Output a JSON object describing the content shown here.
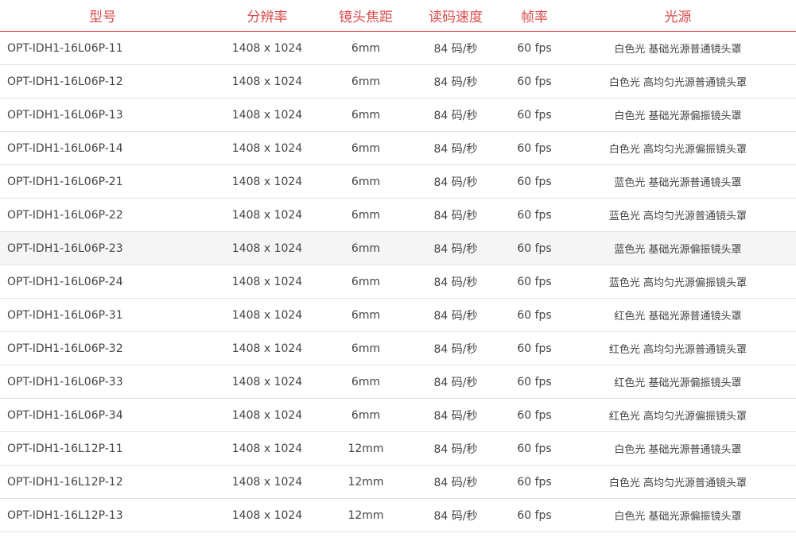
{
  "colors": {
    "header_text": "#d94c4c",
    "header_rule": "#d94c4c",
    "body_text": "#444444",
    "row_rule": "#e3e3e3",
    "highlight_row_bg": "#f5f5f5"
  },
  "table": {
    "headers": [
      "型号",
      "分辨率",
      "镜头焦距",
      "读码速度",
      "帧率",
      "光源"
    ],
    "highlighted_row": 6,
    "rows": [
      [
        "OPT-IDH1-16L06P-11",
        "1408 x 1024",
        "6mm",
        "84 码/秒",
        "60 fps",
        "白色光 基础光源普通镜头罩"
      ],
      [
        "OPT-IDH1-16L06P-12",
        "1408 x 1024",
        "6mm",
        "84 码/秒",
        "60 fps",
        "白色光 高均匀光源普通镜头罩"
      ],
      [
        "OPT-IDH1-16L06P-13",
        "1408 x 1024",
        "6mm",
        "84 码/秒",
        "60 fps",
        "白色光 基础光源偏振镜头罩"
      ],
      [
        "OPT-IDH1-16L06P-14",
        "1408 x 1024",
        "6mm",
        "84 码/秒",
        "60 fps",
        "白色光 高均匀光源偏振镜头罩"
      ],
      [
        "OPT-IDH1-16L06P-21",
        "1408 x 1024",
        "6mm",
        "84 码/秒",
        "60 fps",
        "蓝色光 基础光源普通镜头罩"
      ],
      [
        "OPT-IDH1-16L06P-22",
        "1408 x 1024",
        "6mm",
        "84 码/秒",
        "60 fps",
        "蓝色光 高均匀光源普通镜头罩"
      ],
      [
        "OPT-IDH1-16L06P-23",
        "1408 x 1024",
        "6mm",
        "84 码/秒",
        "60 fps",
        "蓝色光 基础光源偏振镜头罩"
      ],
      [
        "OPT-IDH1-16L06P-24",
        "1408 x 1024",
        "6mm",
        "84 码/秒",
        "60 fps",
        "蓝色光 高均匀光源偏振镜头罩"
      ],
      [
        "OPT-IDH1-16L06P-31",
        "1408 x 1024",
        "6mm",
        "84 码/秒",
        "60 fps",
        "红色光 基础光源普通镜头罩"
      ],
      [
        "OPT-IDH1-16L06P-32",
        "1408 x 1024",
        "6mm",
        "84 码/秒",
        "60 fps",
        "红色光 高均匀光源普通镜头罩"
      ],
      [
        "OPT-IDH1-16L06P-33",
        "1408 x 1024",
        "6mm",
        "84 码/秒",
        "60 fps",
        "红色光 基础光源偏振镜头罩"
      ],
      [
        "OPT-IDH1-16L06P-34",
        "1408 x 1024",
        "6mm",
        "84 码/秒",
        "60 fps",
        "红色光 高均匀光源偏振镜头罩"
      ],
      [
        "OPT-IDH1-16L12P-11",
        "1408 x 1024",
        "12mm",
        "84 码/秒",
        "60 fps",
        "白色光 基础光源普通镜头罩"
      ],
      [
        "OPT-IDH1-16L12P-12",
        "1408 x 1024",
        "12mm",
        "84 码/秒",
        "60 fps",
        "白色光 高均匀光源普通镜头罩"
      ],
      [
        "OPT-IDH1-16L12P-13",
        "1408 x 1024",
        "12mm",
        "84 码/秒",
        "60 fps",
        "白色光 基础光源偏振镜头罩"
      ]
    ]
  }
}
